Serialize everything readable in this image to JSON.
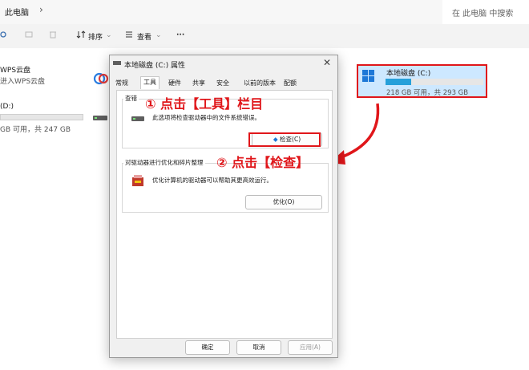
{
  "explorer": {
    "address_title": "此电脑",
    "search_placeholder": "在 此电脑 中搜索",
    "toolbar": {
      "sort_label": "排序",
      "view_label": "查看",
      "more_label": "···"
    },
    "left": {
      "item1": "WPS云盘",
      "item1_sub": "进入WPS云盘",
      "drive_d_name": "(D:)",
      "drive_d_size": "GB 可用，共 247 GB"
    },
    "drive_c": {
      "name": "本地磁盘 (C:)",
      "size": "218 GB 可用，共 293 GB",
      "used_fraction": 0.26
    }
  },
  "dialog": {
    "title": "本地磁盘 (C:) 属性",
    "tabs": [
      "常规",
      "工具",
      "硬件",
      "共享",
      "安全",
      "以前的版本",
      "配额"
    ],
    "active_tab": "工具",
    "check_group_label": "查错",
    "check_desc": "此选项将检查驱动器中的文件系统错误。",
    "check_button": "检查(C)",
    "optimize_group_label": "对驱动器进行优化和碎片整理",
    "optimize_desc": "优化计算机的驱动器可以帮助其更高效运行。",
    "optimize_button": "优化(O)",
    "ok_button": "确定",
    "cancel_button": "取消",
    "apply_button": "应用(A)"
  },
  "annotations": {
    "step1": "① 点击【工具】栏目",
    "step2": "② 点击【检查】"
  },
  "colors": {
    "highlight": "#e0161a",
    "drive_fill": "#26a0da",
    "selected_tile": "#cde8ff"
  }
}
